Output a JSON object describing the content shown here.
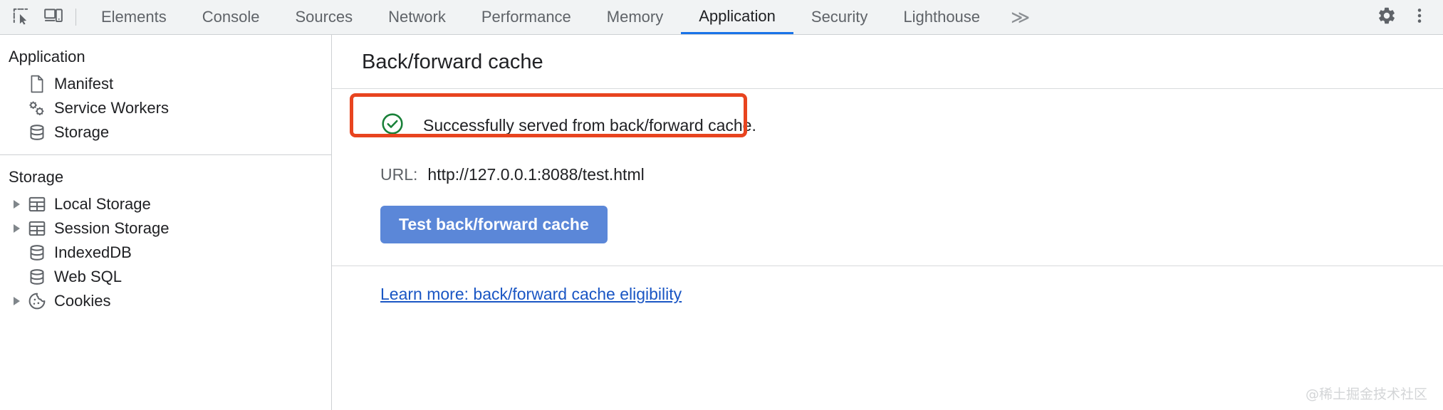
{
  "toolbar": {
    "inspect_icon": "inspect-element-icon",
    "device_icon": "device-toolbar-icon",
    "settings_icon": "gear-icon",
    "menu_icon": "three-dots-vertical-icon",
    "more_tabs_label": "≫",
    "tabs": [
      {
        "label": "Elements",
        "active": false
      },
      {
        "label": "Console",
        "active": false
      },
      {
        "label": "Sources",
        "active": false
      },
      {
        "label": "Network",
        "active": false
      },
      {
        "label": "Performance",
        "active": false
      },
      {
        "label": "Memory",
        "active": false
      },
      {
        "label": "Application",
        "active": true
      },
      {
        "label": "Security",
        "active": false
      },
      {
        "label": "Lighthouse",
        "active": false
      }
    ]
  },
  "sidebar": {
    "sections": [
      {
        "title": "Application",
        "items": [
          {
            "label": "Manifest",
            "icon": "document-icon",
            "expandable": false
          },
          {
            "label": "Service Workers",
            "icon": "gears-icon",
            "expandable": false
          },
          {
            "label": "Storage",
            "icon": "database-icon",
            "expandable": false
          }
        ]
      },
      {
        "title": "Storage",
        "items": [
          {
            "label": "Local Storage",
            "icon": "table-icon",
            "expandable": true
          },
          {
            "label": "Session Storage",
            "icon": "table-icon",
            "expandable": true
          },
          {
            "label": "IndexedDB",
            "icon": "database-icon",
            "expandable": false
          },
          {
            "label": "Web SQL",
            "icon": "database-icon",
            "expandable": false
          },
          {
            "label": "Cookies",
            "icon": "cookie-icon",
            "expandable": true
          }
        ]
      }
    ]
  },
  "main": {
    "title": "Back/forward cache",
    "status": {
      "icon": "check-circle-icon",
      "text": "Successfully served from back/forward cache.",
      "icon_color": "#188038",
      "highlight_color": "#e8441f"
    },
    "url": {
      "label": "URL:",
      "value": "http://127.0.0.1:8088/test.html"
    },
    "button": {
      "label": "Test back/forward cache",
      "color": "#5b87d8"
    },
    "link": {
      "label": "Learn more: back/forward cache eligibility",
      "color": "#1a56c4"
    }
  },
  "watermark": {
    "text": "@稀土掘金技术社区"
  }
}
